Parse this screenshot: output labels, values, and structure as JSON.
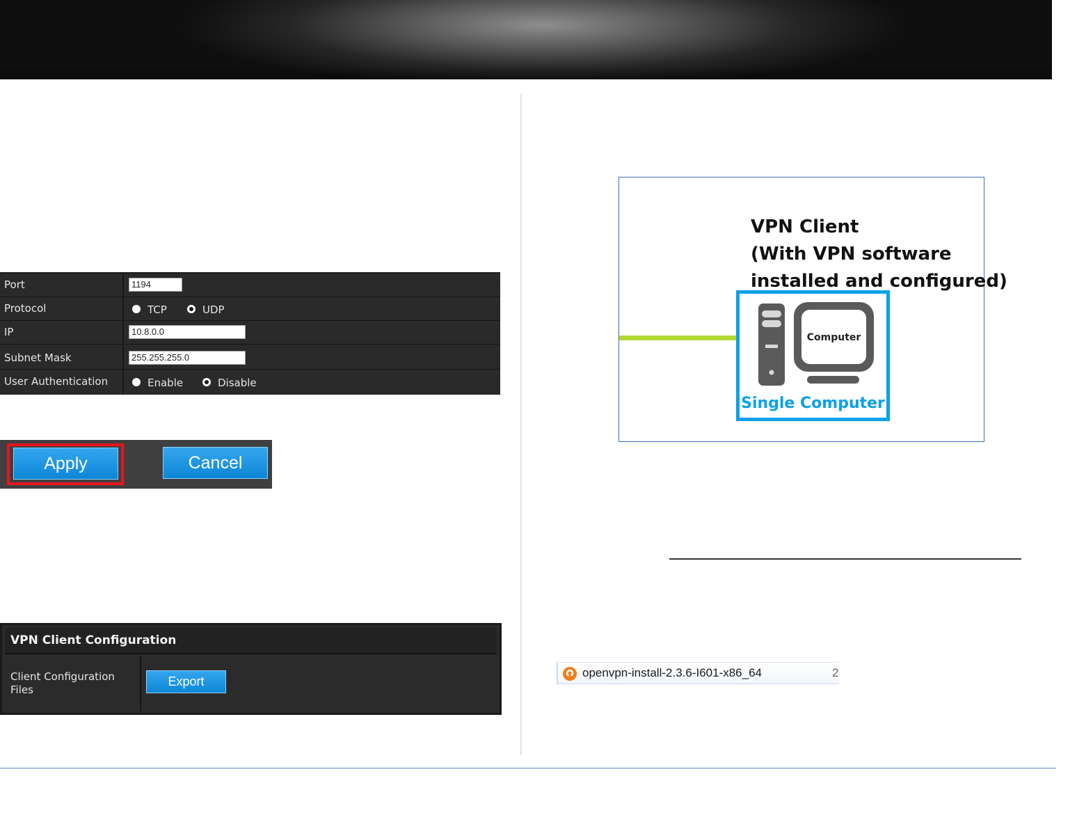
{
  "settings": {
    "rows": [
      {
        "label": "Port",
        "value": "1194"
      },
      {
        "label": "Protocol",
        "options": [
          "TCP",
          "UDP"
        ],
        "selected": "UDP"
      },
      {
        "label": "IP",
        "value": "10.8.0.0"
      },
      {
        "label": "Subnet Mask",
        "value": "255.255.255.0"
      },
      {
        "label": "User Authentication",
        "options": [
          "Enable",
          "Disable"
        ],
        "selected": "Disable"
      }
    ]
  },
  "buttons": {
    "apply_label": "Apply",
    "cancel_label": "Cancel"
  },
  "vpn_config": {
    "title": "VPN Client Configuration",
    "row_label": "Client Configuration Files",
    "export_label": "Export"
  },
  "diagram": {
    "title_lines": [
      "VPN Client",
      "(With VPN software",
      "installed and configured)"
    ],
    "monitor_label": "Computer",
    "caption": "Single Computer"
  },
  "file_entry": {
    "name": "openvpn-install-2.3.6-I601-x86_64",
    "next_column": "2"
  },
  "colors": {
    "accent_blue": "#0ca1e8",
    "highlight_red": "#e8141d",
    "line_green": "#b3d934",
    "table_bg": "#2a2a2a"
  },
  "icons": [
    "computer-tower-icon",
    "monitor-icon",
    "openvpn-icon",
    "radio-button-icon"
  ]
}
